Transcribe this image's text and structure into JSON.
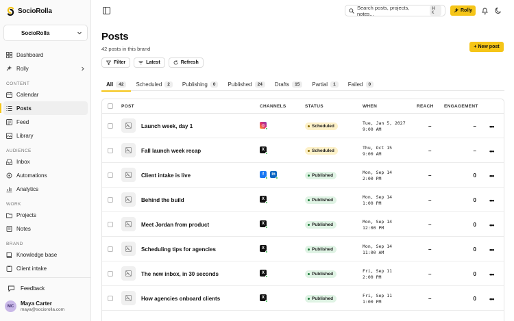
{
  "sidebar": {
    "brand": "SocioRolla",
    "workspace": "SocioRolla",
    "items_top": [
      {
        "label": "Dashboard",
        "icon": "grid-icon"
      },
      {
        "label": "Rolly",
        "icon": "rolly-icon"
      }
    ],
    "section_content": "CONTENT",
    "items_content": [
      {
        "label": "Calendar",
        "icon": "calendar-icon"
      },
      {
        "label": "Posts",
        "icon": "list-icon"
      },
      {
        "label": "Feed",
        "icon": "feed-icon"
      },
      {
        "label": "Library",
        "icon": "library-icon"
      }
    ],
    "section_audience": "AUDIENCE",
    "items_audience": [
      {
        "label": "Inbox",
        "icon": "inbox-icon"
      },
      {
        "label": "Automations",
        "icon": "automations-icon"
      },
      {
        "label": "Analytics",
        "icon": "analytics-icon"
      }
    ],
    "section_work": "WORK",
    "items_work": [
      {
        "label": "Projects",
        "icon": "projects-icon"
      },
      {
        "label": "Notes",
        "icon": "notes-icon"
      }
    ],
    "section_brand": "BRAND",
    "items_brand": [
      {
        "label": "Knowledge base",
        "icon": "book-icon"
      },
      {
        "label": "Client intake",
        "icon": "intake-icon"
      }
    ],
    "feedback": "Feedback",
    "user": {
      "initials": "MC",
      "name": "Maya Carter",
      "email": "maya@sociorolla.com"
    }
  },
  "topbar": {
    "search_placeholder": "Search posts, projects, notes...",
    "search_shortcut": "⌘ K",
    "rolly_label": "Rolly"
  },
  "main": {
    "title": "Posts",
    "subtitle": "42 posts in this brand",
    "new_post": "+ New post",
    "toolbar": {
      "filter": "Filter",
      "latest": "Latest",
      "refresh": "Refresh"
    },
    "tabs": [
      {
        "label": "All",
        "count": "42"
      },
      {
        "label": "Scheduled",
        "count": "2"
      },
      {
        "label": "Publishing",
        "count": "0"
      },
      {
        "label": "Published",
        "count": "24"
      },
      {
        "label": "Drafts",
        "count": "15"
      },
      {
        "label": "Partial",
        "count": "1"
      },
      {
        "label": "Failed",
        "count": "0"
      }
    ],
    "columns": {
      "post": "POST",
      "channels": "CHANNELS",
      "status": "STATUS",
      "when": "WHEN",
      "reach": "REACH",
      "engagement": "ENGAGEMENT"
    },
    "rows": [
      {
        "name": "Launch week, day 1",
        "channels": [
          "ig"
        ],
        "status": "Scheduled",
        "when": "Tue, Jan 5, 2027\n9:00 AM",
        "reach": "–",
        "engagement": "–"
      },
      {
        "name": "Fall launch week recap",
        "channels": [
          "x"
        ],
        "status": "Scheduled",
        "when": "Thu, Oct 15\n9:00 AM",
        "reach": "–",
        "engagement": "–"
      },
      {
        "name": "Client intake is live",
        "channels": [
          "fb",
          "li"
        ],
        "status": "Published",
        "when": "Mon, Sep 14\n2:00 PM",
        "reach": "–",
        "engagement": "0"
      },
      {
        "name": "Behind the build",
        "channels": [
          "x"
        ],
        "status": "Published",
        "when": "Mon, Sep 14\n1:00 PM",
        "reach": "–",
        "engagement": "0"
      },
      {
        "name": "Meet Jordan from product",
        "channels": [
          "x"
        ],
        "status": "Published",
        "when": "Mon, Sep 14\n12:00 PM",
        "reach": "–",
        "engagement": "0"
      },
      {
        "name": "Scheduling tips for agencies",
        "channels": [
          "x"
        ],
        "status": "Published",
        "when": "Mon, Sep 14\n11:00 AM",
        "reach": "–",
        "engagement": "0"
      },
      {
        "name": "The new inbox, in 30 seconds",
        "channels": [
          "x"
        ],
        "status": "Published",
        "when": "Fri, Sep 11\n2:00 PM",
        "reach": "–",
        "engagement": "0"
      },
      {
        "name": "How agencies onboard clients",
        "channels": [
          "x"
        ],
        "status": "Published",
        "when": "Fri, Sep 11\n1:00 PM",
        "reach": "–",
        "engagement": "0"
      }
    ],
    "row_more": "•••"
  },
  "colors": {
    "accent": "#f5c518",
    "published": "#1e7a3a",
    "scheduled": "#8a6a00"
  }
}
